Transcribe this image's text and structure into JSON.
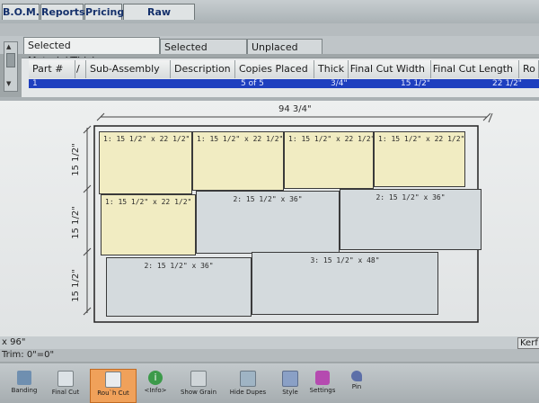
{
  "menu": [
    "B.O.M.",
    "Reports",
    "Pricing",
    "Raw Materials"
  ],
  "tabs": [
    "Selected Material/Thickness",
    "Selected Diagram",
    "Unplaced Parts"
  ],
  "grid": {
    "headers": [
      "Part #",
      "/",
      "Sub-Assembly",
      "Description",
      "Copies Placed",
      "Thick",
      "Final Cut Width",
      "Final Cut Length",
      "Ro"
    ],
    "row": [
      "1",
      "5 of 5",
      "3/4\"",
      "15 1/2\"",
      "22 1/2\""
    ]
  },
  "diagram": {
    "top_dim": "94 3/4\"",
    "left_dims": [
      "15 1/2\"",
      "15 1/2\"",
      "15 1/2\""
    ],
    "parts": [
      "1: 15 1/2\" x 22 1/2\"",
      "1: 15 1/2\" x 22 1/2\"",
      "1: 15 1/2\" x 22 1/2\"",
      "1: 15 1/2\" x 22 1/2\"",
      "1: 15 1/2\" x 22 1/2\"",
      "2: 15 1/2\" x 36\"",
      "2: 15 1/2\" x 36\"",
      "2: 15 1/2\" x 36\"",
      "3: 15 1/2\" x 48\""
    ]
  },
  "status": {
    "left1": "x 96\"",
    "left2": "Trim: 0\"=0\"",
    "right1": "Kerf"
  },
  "toolbar": [
    "Banding",
    "Final Cut",
    "Rou`h Cut",
    "<Info>",
    "Show Grain",
    "Hide Dupes",
    "Style",
    "Settings",
    "Pin"
  ],
  "colors": {
    "yellow_part": "#f1ecc2",
    "blue_part": "#d4dadd",
    "selected_row": "#1e3fbf",
    "active_tool": "#f0a15a"
  }
}
